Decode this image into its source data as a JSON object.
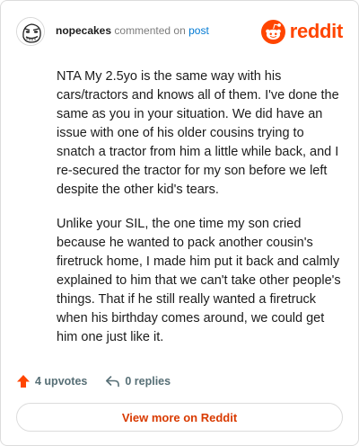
{
  "comment": {
    "username": "nopecakes",
    "action_text": "commented on",
    "target_link": "post",
    "paragraphs": [
      "NTA My 2.5yo is the same way with his cars/tractors and knows all of them. I've done the same as you in your situation. We did have an issue with one of his older cousins trying to snatch a tractor from him a little while back, and I re-secured the tractor for my son before we left despite the other kid's tears.",
      "Unlike your SIL, the one time my son cried because he wanted to pack another cousin's firetruck home, I made him put it back and calmly explained to him that we can't take other people's things. That if he still really wanted a firetruck when his birthday comes around, we could get him one just like it."
    ]
  },
  "brand": {
    "name": "reddit",
    "icon": "reddit-snoo-icon",
    "color": "#ff4500"
  },
  "actions": {
    "upvotes_label": "4 upvotes",
    "replies_label": "0 replies",
    "upvote_icon": "upvote-arrow-icon",
    "reply_icon": "reply-arrow-icon",
    "upvote_color": "#ff4500"
  },
  "footer": {
    "view_more_label": "View more on Reddit"
  }
}
